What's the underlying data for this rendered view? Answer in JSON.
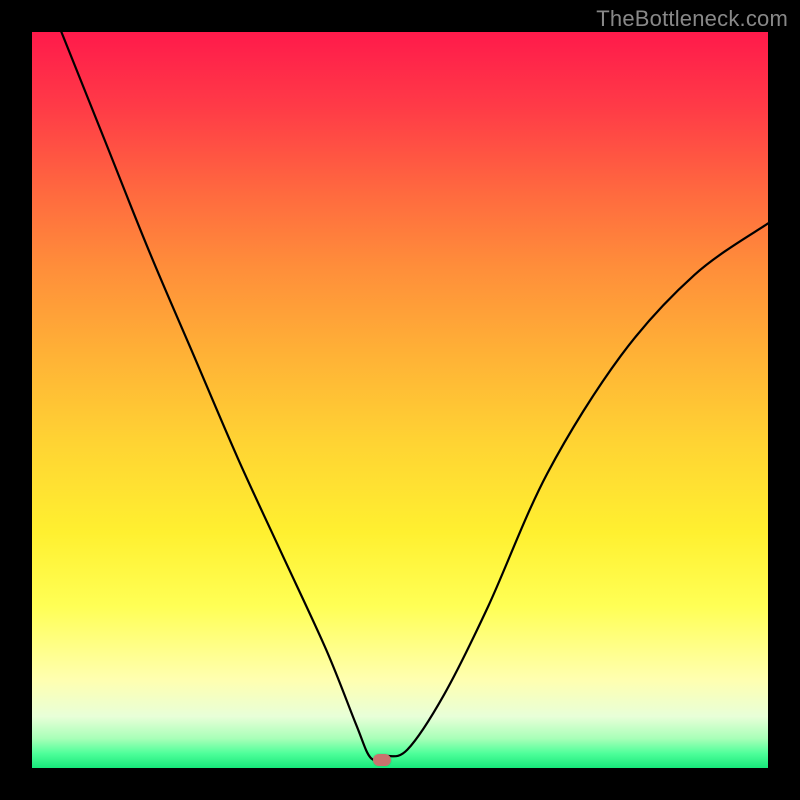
{
  "watermark": "TheBottleneck.com",
  "marker": {
    "x_pct": 47.5,
    "y_pct": 98.9
  },
  "curve": {
    "left_start": {
      "x_pct": 4.0,
      "y_pct": 0.0
    },
    "vertex": {
      "x_pct": 46.0,
      "y_pct": 98.6
    },
    "right_start": {
      "x_pct": 51.0,
      "y_pct": 97.5
    },
    "right_end": {
      "x_pct": 100.0,
      "y_pct": 26.0
    }
  },
  "chart_data": {
    "type": "line",
    "title": "",
    "xlabel": "",
    "ylabel": "",
    "xlim": [
      0,
      100
    ],
    "ylim": [
      0,
      100
    ],
    "series": [
      {
        "name": "bottleneck-curve",
        "x": [
          4,
          10,
          16,
          22,
          28,
          34,
          40,
          44,
          46,
          48,
          51,
          56,
          62,
          70,
          80,
          90,
          100
        ],
        "y": [
          100,
          85,
          70,
          56,
          42,
          29,
          16,
          6,
          1.4,
          1.6,
          2.5,
          10,
          22,
          40,
          56,
          67,
          74
        ]
      }
    ],
    "annotations": [
      {
        "name": "optimal-marker",
        "x": 47.5,
        "y": 1.1
      }
    ],
    "background_gradient": {
      "direction": "vertical",
      "stops": [
        {
          "pct": 0,
          "color": "#ff1a4b"
        },
        {
          "pct": 50,
          "color": "#ffd433"
        },
        {
          "pct": 88,
          "color": "#ffffb0"
        },
        {
          "pct": 100,
          "color": "#17e87a"
        }
      ]
    }
  }
}
